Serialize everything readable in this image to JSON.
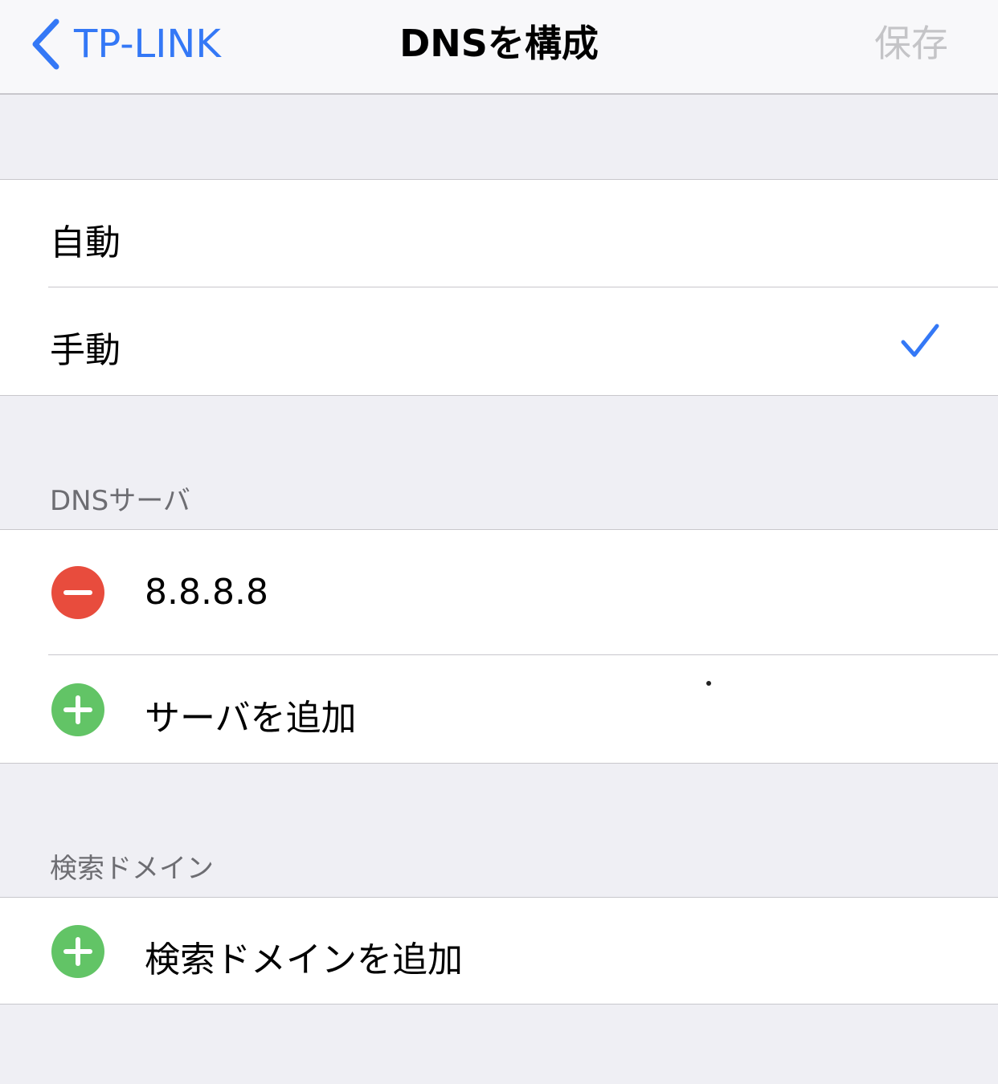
{
  "navbar": {
    "back_label": "TP-LINK",
    "title": "DNSを構成",
    "save_label": "保存"
  },
  "mode": {
    "options": [
      {
        "label": "自動",
        "selected": false
      },
      {
        "label": "手動",
        "selected": true
      }
    ]
  },
  "dns_servers": {
    "header": "DNSサーバ",
    "servers": [
      "8.8.8.8"
    ],
    "add_label": "サーバを追加"
  },
  "search_domains": {
    "header": "検索ドメイン",
    "add_label": "検索ドメインを追加"
  },
  "colors": {
    "accent": "#3478f6",
    "remove": "#e84c3d",
    "add": "#62c466"
  },
  "icons": [
    "chevron-left-icon",
    "checkmark-icon",
    "minus-circle-icon",
    "plus-circle-icon"
  ]
}
